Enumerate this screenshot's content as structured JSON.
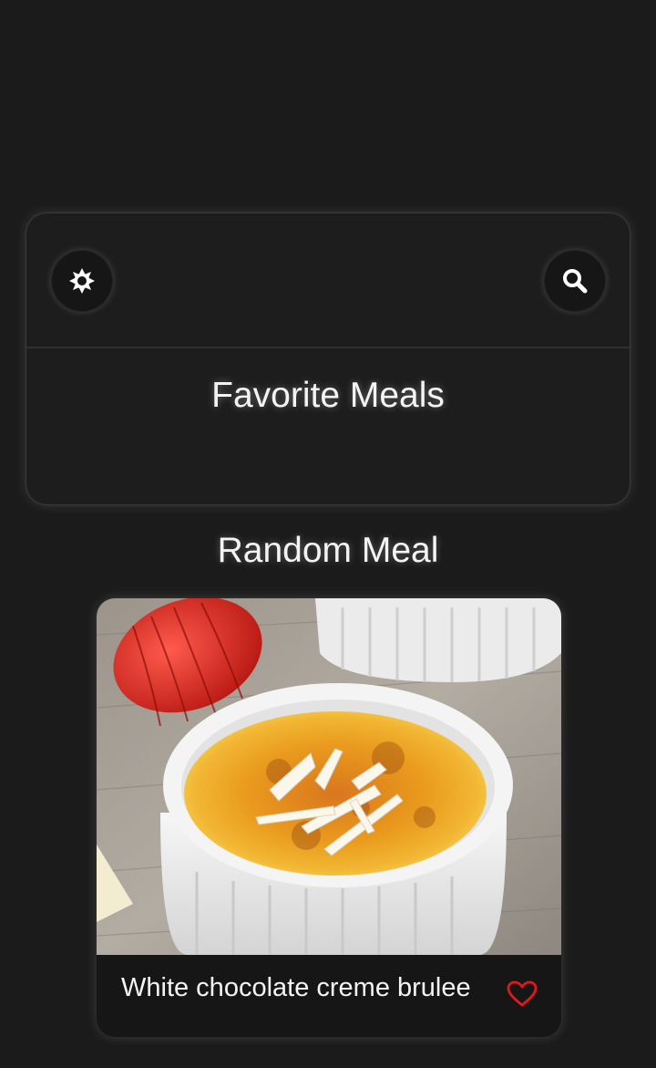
{
  "header": {
    "theme_toggle_icon": "sun-icon",
    "search_icon": "search-icon",
    "title": "Favorite Meals"
  },
  "random_meal": {
    "section_title": "Random Meal",
    "meal_name": "White chocolate creme brulee",
    "favorite_icon": "heart-outline-icon",
    "favorite_color": "#e0191f"
  },
  "colors": {
    "background": "#1b1b1b",
    "card": "#1d1d1d",
    "text": "#f4f4f4"
  }
}
